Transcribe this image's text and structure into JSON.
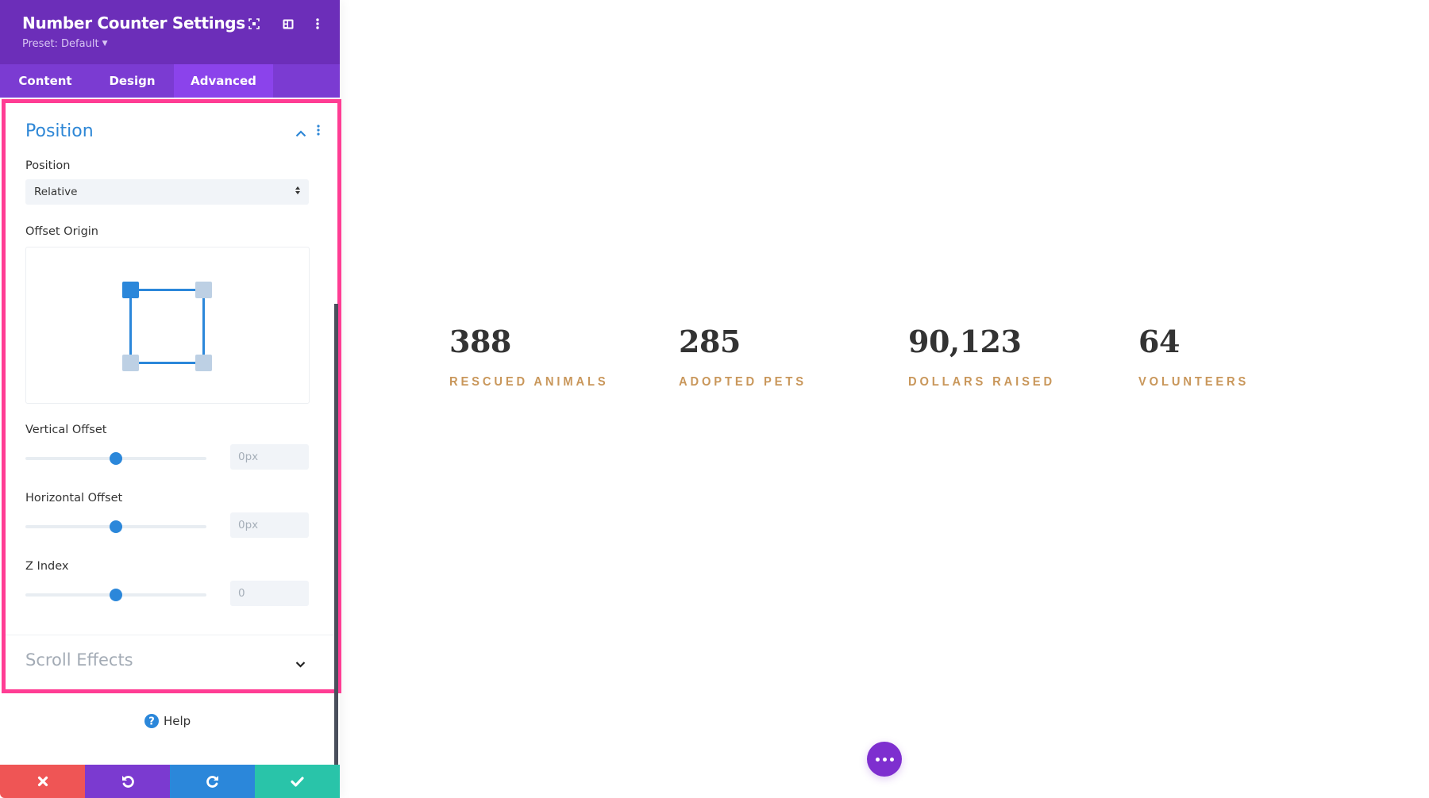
{
  "panel": {
    "title": "Number Counter Settings",
    "preset": "Preset: Default",
    "header_icons": [
      "fullscreen-icon",
      "split-view-icon",
      "more-options-icon"
    ],
    "tabs": [
      {
        "label": "Content",
        "active": false
      },
      {
        "label": "Design",
        "active": false
      },
      {
        "label": "Advanced",
        "active": true
      }
    ],
    "position_section": {
      "title": "Position",
      "expanded": true,
      "position_label": "Position",
      "position_value": "Relative",
      "offset_origin_label": "Offset Origin",
      "offset_origin_selected": "top-left",
      "vertical_offset": {
        "label": "Vertical Offset",
        "value": "0px",
        "slider_percent": 50
      },
      "horizontal_offset": {
        "label": "Horizontal Offset",
        "value": "0px",
        "slider_percent": 50
      },
      "z_index": {
        "label": "Z Index",
        "value": "0",
        "slider_percent": 50
      }
    },
    "scroll_effects_section": {
      "title": "Scroll Effects",
      "expanded": false
    },
    "help_label": "Help",
    "bottom_buttons": [
      "discard",
      "undo",
      "redo",
      "save"
    ]
  },
  "colors": {
    "header": "#6c2eb9",
    "tab_bar": "#7b3bd2",
    "tab_active": "#8b43eb",
    "highlight": "#ff3d94",
    "accent_blue": "#2b87da",
    "discard": "#ef5555",
    "undo": "#7b3ad0",
    "redo": "#2b87da",
    "save": "#29c4a9",
    "counter_label": "#c9975b"
  },
  "counters": [
    {
      "number": "388",
      "label": "RESCUED ANIMALS"
    },
    {
      "number": "285",
      "label": "ADOPTED PETS"
    },
    {
      "number": "90,123",
      "label": "DOLLARS RAISED"
    },
    {
      "number": "64",
      "label": "VOLUNTEERS"
    }
  ]
}
